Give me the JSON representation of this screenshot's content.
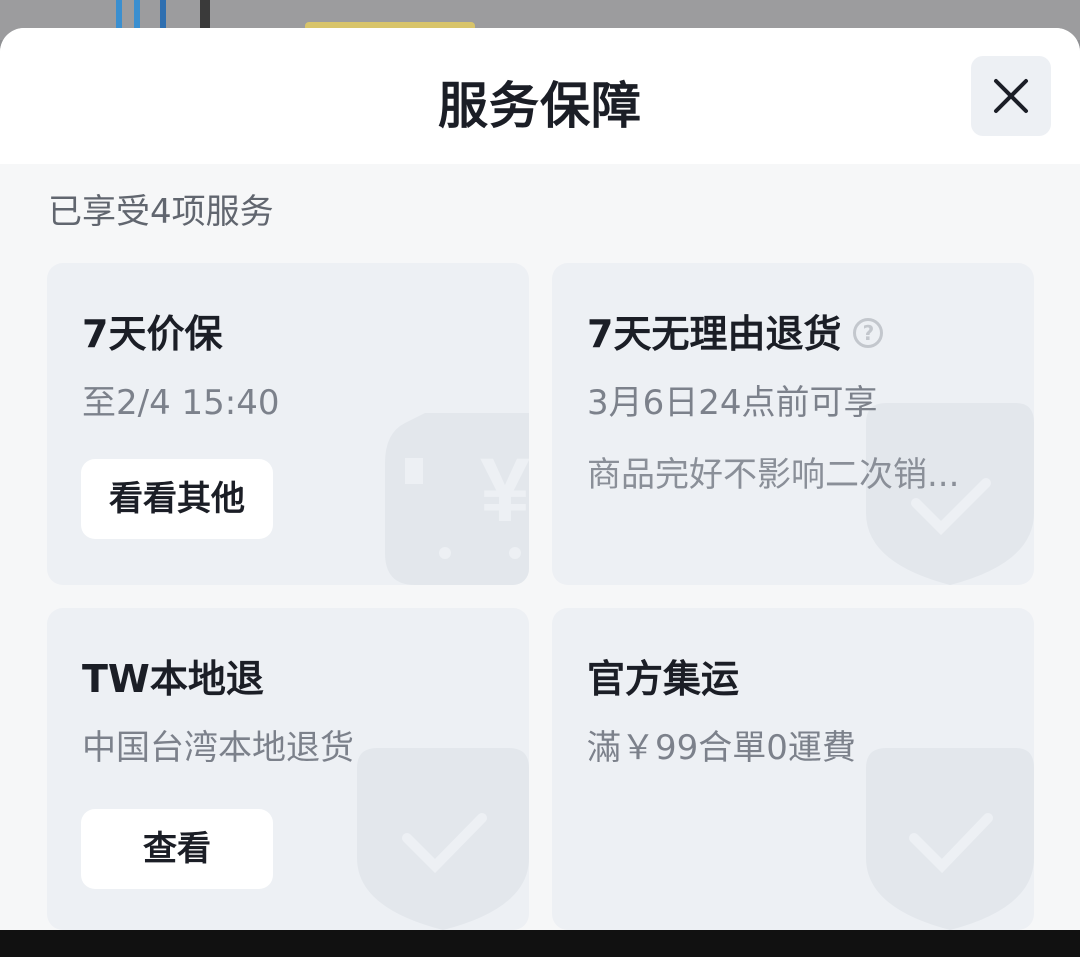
{
  "sheet": {
    "title": "服务保障",
    "close_icon": "close-icon",
    "summary": "已享受4项服务"
  },
  "cards": [
    {
      "title": "7天价保",
      "subtitle": "至2/4 15:40",
      "button": "看看其他",
      "watermark_icon": "price-protection-icon"
    },
    {
      "title": "7天无理由退货",
      "help_icon": "help-icon",
      "help_glyph": "?",
      "subtitle": "3月6日24点前可享",
      "description": "商品完好不影响二次销...",
      "watermark_icon": "shield-check-icon"
    },
    {
      "title": "TW本地退",
      "subtitle": "中国台湾本地退货",
      "button": "查看",
      "watermark_icon": "shield-check-icon"
    },
    {
      "title": "官方集运",
      "subtitle": "滿￥99合單0運費",
      "watermark_icon": "shield-check-icon"
    }
  ],
  "colors": {
    "card_bg": "#edf0f4",
    "title_text": "#1b1e26",
    "secondary_text": "#7c818b",
    "watermark": "#e3e7ec"
  }
}
